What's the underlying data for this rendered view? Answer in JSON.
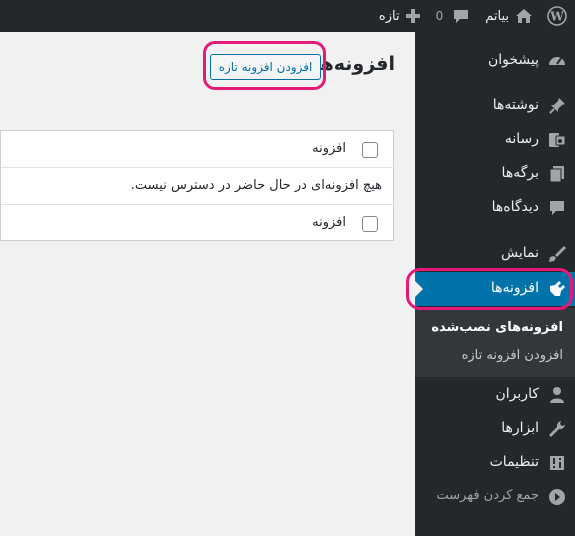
{
  "adminbar": {
    "site_name": "بیاتم",
    "comments_count": "0",
    "new_label": "تازه"
  },
  "sidebar": {
    "items": [
      {
        "label": "پیشخوان",
        "icon": "dashboard-icon"
      },
      {
        "label": "نوشته‌ها",
        "icon": "pin-icon"
      },
      {
        "label": "رسانه",
        "icon": "media-icon"
      },
      {
        "label": "برگه‌ها",
        "icon": "pages-icon"
      },
      {
        "label": "دیدگاه‌ها",
        "icon": "comments-icon"
      },
      {
        "label": "نمایش",
        "icon": "appearance-icon"
      },
      {
        "label": "افزونه‌ها",
        "icon": "plugins-icon"
      },
      {
        "label": "کاربران",
        "icon": "users-icon"
      },
      {
        "label": "ابزارها",
        "icon": "tools-icon"
      },
      {
        "label": "تنظیمات",
        "icon": "settings-icon"
      }
    ],
    "submenu": [
      "افزونه‌های نصب‌شده",
      "افزودن افزونه تازه"
    ],
    "collapse_label": "جمع کردن فهرست"
  },
  "main": {
    "title": "افزونه‌ها",
    "add_new_button": "افزودن افزونه تازه",
    "table": {
      "column_header": "افزونه",
      "empty_message": "هیچ افزونه‌ای در حال حاضر در دسترس نیست.",
      "column_footer": "افزونه"
    }
  },
  "colors": {
    "adminbar_bg": "#23282d",
    "sidebar_bg": "#23282d",
    "submenu_bg": "#32373c",
    "active_bg": "#0073aa",
    "highlight": "#e5197a",
    "button_text": "#0071a1"
  }
}
